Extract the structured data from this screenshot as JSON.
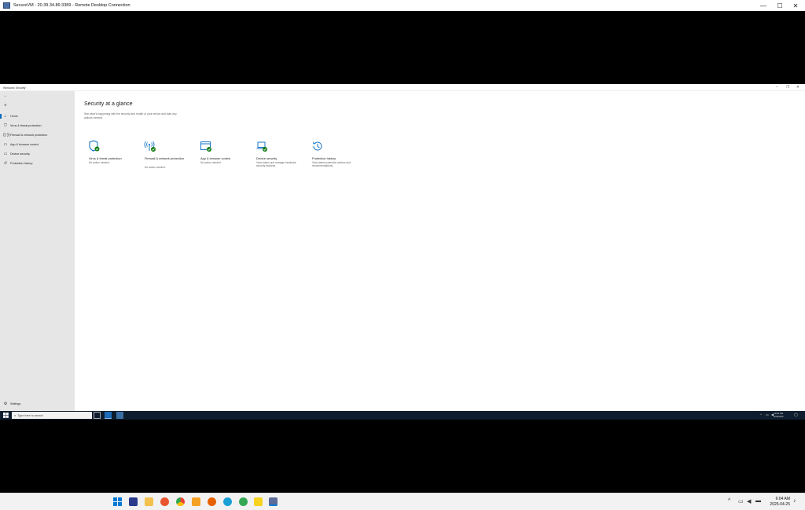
{
  "rdp": {
    "title": "SecureVM - 20.39.34.86:3389 - Remote Desktop Connection",
    "minimize": "—",
    "maximize": "☐",
    "close": "✕"
  },
  "app": {
    "title": "Windows Security",
    "minimize": "–",
    "restore": "❐",
    "close": "✕"
  },
  "sidebar": {
    "items": [
      {
        "label": "Home"
      },
      {
        "label": "Virus & threat protection"
      },
      {
        "label": "Firewall & network protection"
      },
      {
        "label": "App & browser control"
      },
      {
        "label": "Device security"
      },
      {
        "label": "Protection history"
      }
    ],
    "settings": "Settings"
  },
  "main": {
    "title": "Security at a glance",
    "subtitle": "See what's happening with the security and health of your device and take any actions needed.",
    "tiles": [
      {
        "title": "Virus & threat protection",
        "desc": "No action needed.",
        "icon": "shield-icon"
      },
      {
        "title": "Firewall & network protection",
        "desc": "No action needed.",
        "icon": "antenna-icon"
      },
      {
        "title": "App & browser control",
        "desc": "No action needed.",
        "icon": "browser-icon"
      },
      {
        "title": "Device security",
        "desc": "View status and manage hardware security features.",
        "icon": "laptop-icon"
      },
      {
        "title": "Protection history",
        "desc": "View latest protection actions and recommendations.",
        "icon": "history-icon"
      }
    ]
  },
  "remote_taskbar": {
    "search_placeholder": "Type here to search",
    "time": "10:04 AM",
    "date": "4/25/2025"
  },
  "local_taskbar": {
    "time": "6:04 AM",
    "date": "2025-04-25"
  },
  "colors": {
    "accent": "#0067c0",
    "ok_green": "#107c10",
    "sidebar_bg": "#e6e6e6"
  }
}
